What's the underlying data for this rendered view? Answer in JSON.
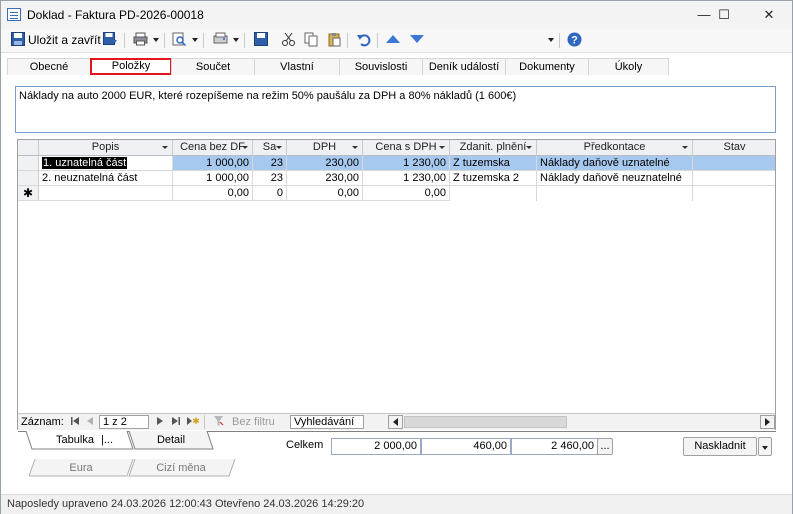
{
  "window": {
    "title": "Doklad - Faktura PD-2026-00018",
    "minimize": "—",
    "maximize": "☐",
    "close": "✕"
  },
  "toolbar": {
    "save_close_label": "Uložit a zavřít"
  },
  "tabs": [
    {
      "label": "Obecné",
      "active": false
    },
    {
      "label": "Položky",
      "active": true
    },
    {
      "label": "Součet",
      "active": false
    },
    {
      "label": "Vlastní",
      "active": false
    },
    {
      "label": "Souvislosti",
      "active": false
    },
    {
      "label": "Deník událostí",
      "active": false
    },
    {
      "label": "Dokumenty",
      "active": false
    },
    {
      "label": "Úkoly",
      "active": false
    }
  ],
  "memo": {
    "text": "Náklady na auto 2000 EUR, které rozepíšeme na režim 50% paušálu za DPH a 80% nákladů (1 600€)"
  },
  "grid": {
    "columns": [
      "Popis",
      "Cena bez DF",
      "Sa",
      "DPH",
      "Cena s DPH",
      "Zdanit. plnění",
      "Předkontace",
      "Stav"
    ],
    "rows": [
      [
        "1. uznatelná část",
        "1 000,00",
        "23",
        "230,00",
        "1 230,00",
        "Z tuzemska",
        "Náklady daňově uznatelné",
        ""
      ],
      [
        "2. neuznatelná část",
        "1 000,00",
        "23",
        "230,00",
        "1 230,00",
        "Z tuzemska 2",
        "Náklady daňově neuznatelné",
        ""
      ],
      [
        "",
        "0,00",
        "0",
        "0,00",
        "0,00",
        "",
        "",
        ""
      ]
    ],
    "new_row_marker": "✱"
  },
  "navigator": {
    "record_label": "Záznam:",
    "position": "1 z 2",
    "filter_label": "Bez filtru",
    "search_label": "Vyhledávání"
  },
  "bottom": {
    "tab_table": "Tabulka",
    "tab_table_more": "|...",
    "tab_detail": "Detail",
    "tab_eura": "Eura",
    "tab_foreign": "Cizí měna",
    "total_label": "Celkem",
    "total_without_vat": "2 000,00",
    "total_vat": "460,00",
    "total_with_vat": "2 460,00",
    "ellipsis": "...",
    "stock_button": "Naskladnit"
  },
  "status": {
    "text": "Naposledy upraveno 24.03.2026 12:00:43 Otevřeno 24.03.2026 14:29:20"
  },
  "colors": {
    "accent": "#e3141b",
    "selected_row": "#a7c9ef",
    "toolbar_blue": "#2f66c0"
  }
}
